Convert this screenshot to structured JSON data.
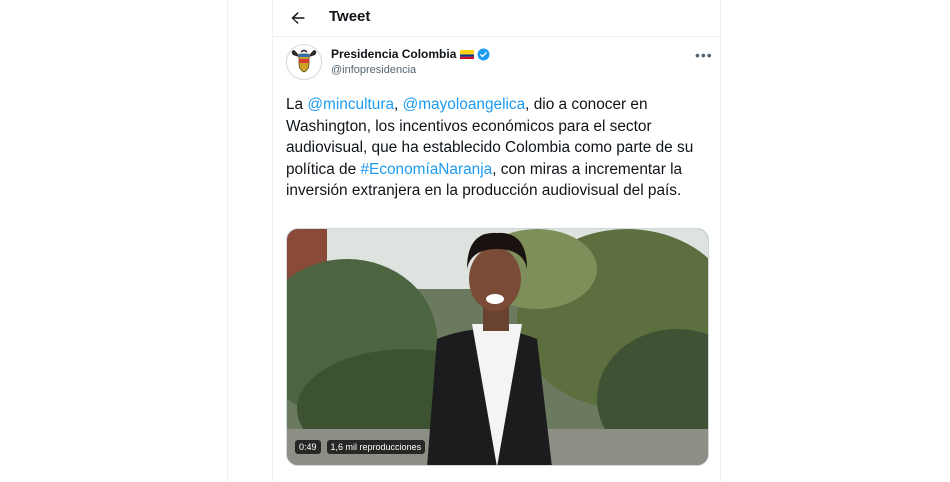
{
  "header": {
    "title": "Tweet",
    "back_icon": "back-arrow-icon"
  },
  "author": {
    "name": "Presidencia Colombia",
    "handle": "@infopresidencia",
    "flag_icon": "colombia-flag-icon",
    "verified_icon": "verified-badge-icon"
  },
  "more_icon": "more-options-icon",
  "tweet": {
    "segments": [
      {
        "text": "La ",
        "link": false
      },
      {
        "text": "@mincultura",
        "link": true
      },
      {
        "text": ", ",
        "link": false
      },
      {
        "text": "@mayoloangelica",
        "link": true
      },
      {
        "text": ", dio a conocer en Washington, los incentivos económicos para el sector audiovisual, que ha establecido Colombia como parte de su política de ",
        "link": false
      },
      {
        "text": "#EconomíaNaranja",
        "link": true
      },
      {
        "text": ", con miras a incrementar la inversión extranjera en la producción audiovisual del país.",
        "link": false
      }
    ]
  },
  "video": {
    "duration": "0:49",
    "views": "1,6 mil reproducciones"
  },
  "colors": {
    "link": "#1d9bf0",
    "text": "#0f1419",
    "secondary": "#536471",
    "border": "#eff3f4"
  }
}
